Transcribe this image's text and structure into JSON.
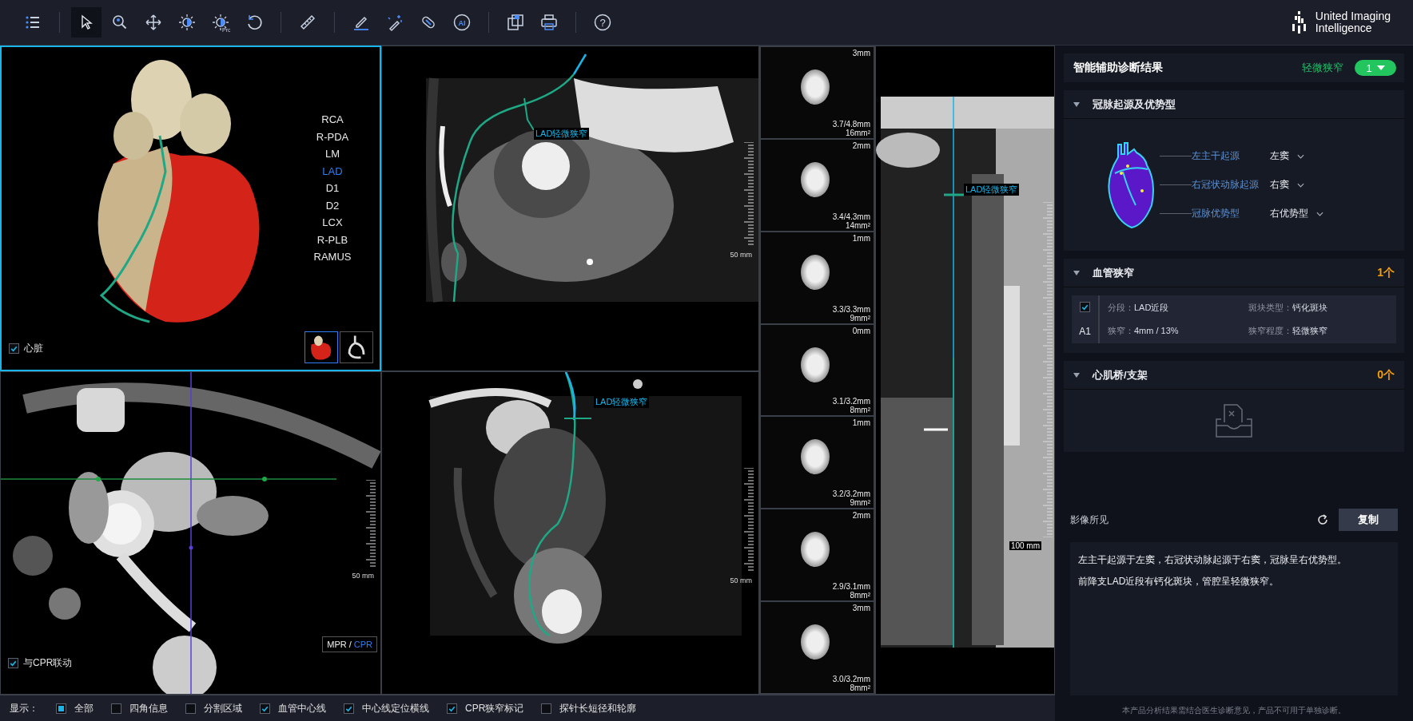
{
  "toolbar": {
    "tool_groups": [
      [
        {
          "kind": "list",
          "selected": false
        }
      ],
      [
        {
          "kind": "pointer",
          "selected": true
        },
        {
          "kind": "zoom",
          "selected": false
        },
        {
          "kind": "pan",
          "selected": false
        },
        {
          "kind": "window",
          "selected": false
        },
        {
          "kind": "window_pro",
          "selected": false,
          "label": "Pro"
        },
        {
          "kind": "rotate",
          "selected": false
        }
      ],
      [
        {
          "kind": "ruler",
          "selected": false
        }
      ],
      [
        {
          "kind": "pen",
          "selected": false
        },
        {
          "kind": "wand",
          "selected": false
        },
        {
          "kind": "eraser",
          "selected": false
        },
        {
          "kind": "ai",
          "selected": false,
          "label": "AI"
        }
      ],
      [
        {
          "kind": "save",
          "selected": false
        },
        {
          "kind": "print",
          "selected": false
        }
      ],
      [
        {
          "kind": "help",
          "selected": false,
          "label": "?"
        }
      ]
    ],
    "logo": {
      "line_1": "United Imaging",
      "line_2": "Intelligence"
    }
  },
  "viewer": {
    "volume_view": {
      "selected": true,
      "vessels": [
        {
          "name": "RCA",
          "selected": false
        },
        {
          "name": "R-PDA",
          "selected": false
        },
        {
          "name": "LM",
          "selected": false
        },
        {
          "name": "LAD",
          "selected": true
        },
        {
          "name": "D1",
          "selected": false
        },
        {
          "name": "D2",
          "selected": false
        },
        {
          "name": "LCX",
          "selected": false
        },
        {
          "name": "R-PLB",
          "selected": false
        },
        {
          "name": "RAMUS",
          "selected": false
        }
      ],
      "heart_toggle": {
        "label": "心脏",
        "checked": true
      },
      "thumbnails": [
        {
          "kind": "heart",
          "selected": true
        },
        {
          "kind": "vessels",
          "selected": false
        }
      ]
    },
    "cpr_view": {
      "selected": false,
      "annotation": "LAD轻微狭窄",
      "scale": "50 mm"
    },
    "axial_view": {
      "selected": false,
      "scale": "50 mm",
      "modes": [
        {
          "label": "MPR",
          "selected": false
        },
        {
          "label": "CPR",
          "selected": true
        }
      ],
      "mode_separator": "/",
      "sync_toggle": {
        "label": "与CPR联动",
        "checked": true
      }
    },
    "cpr_view_2": {
      "selected": false,
      "annotation": "LAD轻微狭窄",
      "scale": "50 mm"
    },
    "cross_sections": [
      {
        "offset": "3mm",
        "diameter": "3.7/4.8mm",
        "area": "16mm²"
      },
      {
        "offset": "2mm",
        "diameter": "3.4/4.3mm",
        "area": "14mm²"
      },
      {
        "offset": "1mm",
        "diameter": "3.3/3.3mm",
        "area": "9mm²"
      },
      {
        "offset": "0mm",
        "diameter": "3.1/3.2mm",
        "area": "8mm²"
      },
      {
        "offset": "1mm",
        "diameter": "3.2/3.2mm",
        "area": "9mm²"
      },
      {
        "offset": "2mm",
        "diameter": "2.9/3.1mm",
        "area": "8mm²"
      },
      {
        "offset": "3mm",
        "diameter": "3.0/3.2mm",
        "area": "8mm²"
      }
    ],
    "straightened_view": {
      "selected": false,
      "annotation": "LAD轻微狭窄",
      "scale": "100 mm"
    }
  },
  "display_bar": {
    "label": "显示：",
    "options": [
      {
        "kind": "all",
        "label": "全部",
        "checked": true
      },
      {
        "kind": "option",
        "label": "四角信息",
        "checked": false
      },
      {
        "kind": "option",
        "label": "分割区域",
        "checked": false
      },
      {
        "kind": "option",
        "label": "血管中心线",
        "checked": true
      },
      {
        "kind": "option",
        "label": "中心线定位横线",
        "checked": true
      },
      {
        "kind": "option",
        "label": "CPR狭窄标记",
        "checked": true
      },
      {
        "kind": "option",
        "label": "探针长短径和轮廓",
        "checked": false
      }
    ]
  },
  "diagnosis_panel": {
    "title": "智能辅助诊断结果",
    "status": "轻微狭窄",
    "result_badge": "1",
    "sections": [
      {
        "kind": "origin",
        "title": "冠脉起源及优势型",
        "expanded": true,
        "items": [
          {
            "label": "左主干起源",
            "value": "左窦"
          },
          {
            "label": "右冠状动脉起源",
            "value": "右窦"
          },
          {
            "label": "冠脉优势型",
            "value": "右优势型"
          }
        ]
      },
      {
        "kind": "stenosis",
        "title": "血管狭窄",
        "expanded": true,
        "count": "1个",
        "findings": [
          {
            "checked": true,
            "id": "A1",
            "fields": [
              {
                "label": "分段：",
                "value": "LAD近段"
              },
              {
                "label": "斑块类型：",
                "value": "钙化斑块"
              },
              {
                "label": "狭窄：",
                "value": "4mm / 13%"
              },
              {
                "label": "狭窄程度：",
                "value": "轻微狭窄"
              }
            ]
          }
        ]
      },
      {
        "kind": "empty",
        "title": "心肌桥/支架",
        "expanded": true,
        "count": "0个"
      }
    ],
    "report": {
      "label": "影像所见",
      "copy_button": "复制",
      "lines": [
        "左主干起源于左窦，右冠状动脉起源于右窦，冠脉呈右优势型。",
        "前降支LAD近段有钙化斑块，管腔呈轻微狭窄。"
      ]
    },
    "disclaimer": "本产品分析结果需结合医生诊断意见，产品不可用于单独诊断。"
  }
}
